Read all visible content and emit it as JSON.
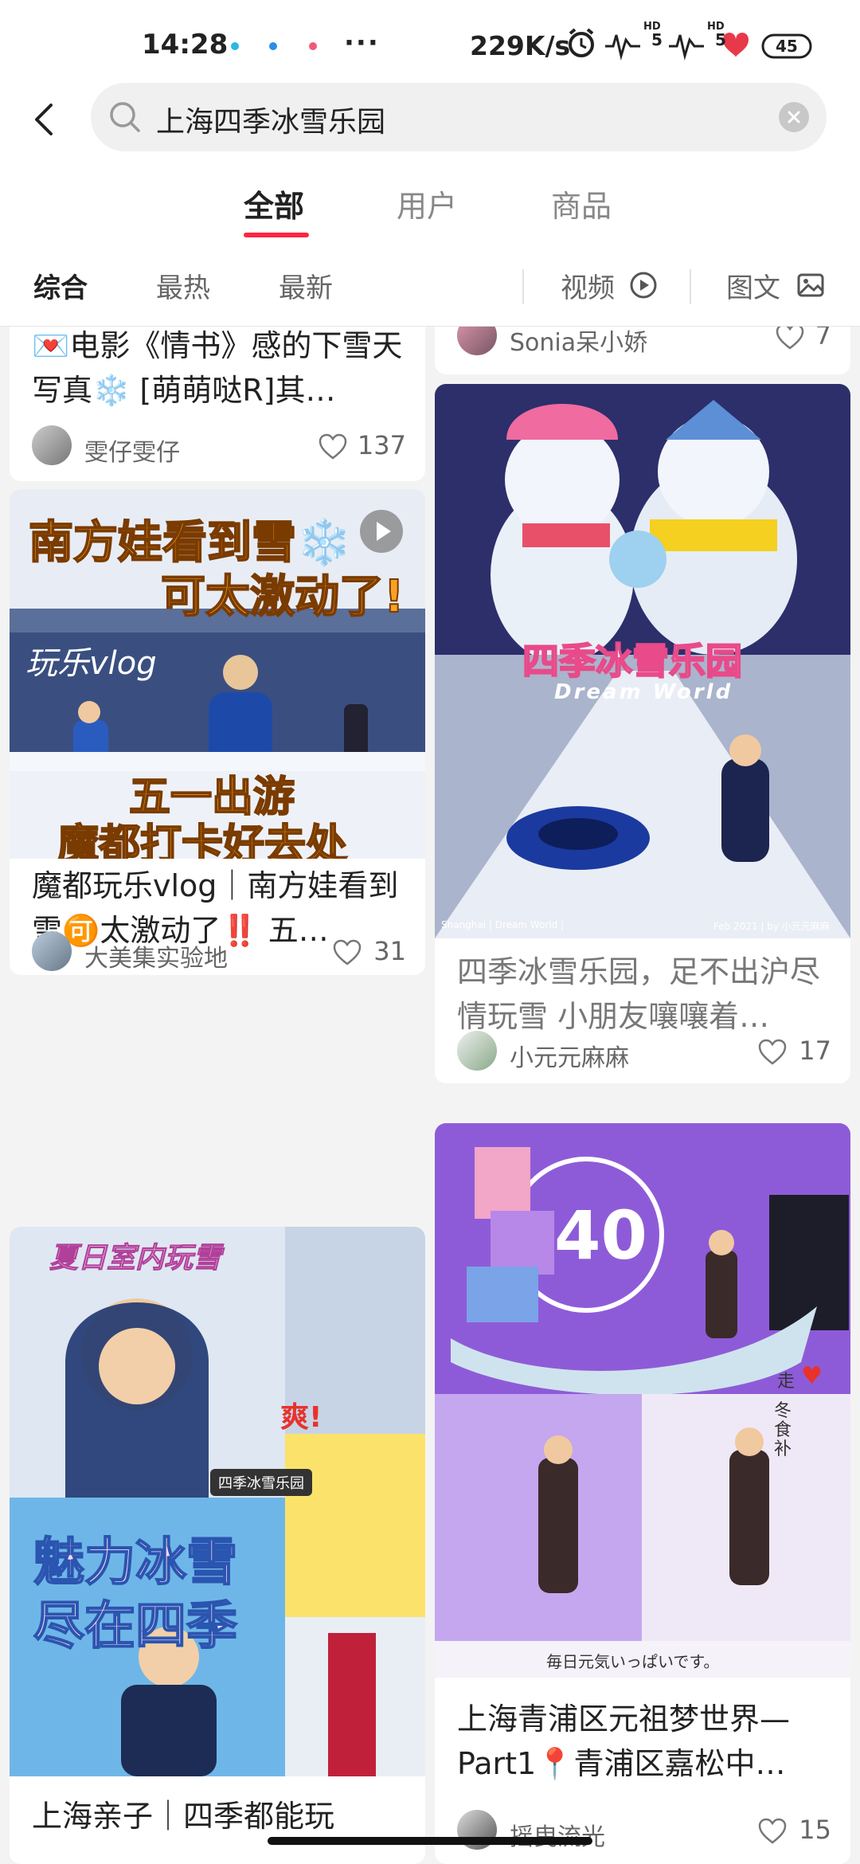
{
  "status_bar": {
    "time": "14:28",
    "more": "···",
    "net_speed": "229K/s",
    "battery": "45",
    "hd_labels": [
      "HD",
      "5",
      "HD",
      "5"
    ]
  },
  "search": {
    "query": "上海四季冰雪乐园",
    "icon": "search-icon"
  },
  "tabs": [
    {
      "label": "全部",
      "active": true
    },
    {
      "label": "用户",
      "active": false
    },
    {
      "label": "商品",
      "active": false
    }
  ],
  "filters": {
    "sort": [
      {
        "label": "综合",
        "active": true
      },
      {
        "label": "最热",
        "active": false
      },
      {
        "label": "最新",
        "active": false
      }
    ],
    "video_label": "视频",
    "image_text_label": "图文"
  },
  "colors": {
    "accent": "#ff2442",
    "background": "#f3f3f3"
  },
  "feed": {
    "left": [
      {
        "title": "💌电影《情书》感的下雪天写真❄️ [萌萌哒R]其…",
        "author": "雯仔雯仔",
        "likes": "137"
      },
      {
        "title": "魔都玩乐vlog｜南方娃看到雪🉑太激动了‼️ 五…",
        "author": "大美集实验地",
        "likes": "31",
        "cover_text": [
          "南方娃看到雪❄️",
          "可太激动了!",
          "玩乐vlog",
          "五一出游",
          "魔都打卡好去处"
        ]
      },
      {
        "title": "上海亲子｜四季都能玩",
        "author": "",
        "likes": "",
        "cover_text": [
          "夏日室内玩雪",
          "爽!",
          "四季冰雪乐园",
          "魅力冰雪",
          "尽在四季"
        ]
      }
    ],
    "right": [
      {
        "title": "",
        "author": "Sonia呆小娇",
        "likes": "7"
      },
      {
        "title": "四季冰雪乐园，足不出沪尽情玩雪 小朋友嚷嚷着…",
        "author": "小元元麻麻",
        "likes": "17",
        "cover_text": [
          "四季冰雪乐园",
          "Dream World",
          "Shanghai | Dream World |",
          "Feb 2021 | by 小元元麻麻"
        ]
      },
      {
        "title": "上海青浦区元祖梦世界—Part1📍青浦区嘉松中…",
        "author": "摇曳流光",
        "likes": "15",
        "cover_text": [
          "40",
          "冬食补",
          "走",
          "毎日元気いっぱいです。"
        ]
      }
    ]
  }
}
